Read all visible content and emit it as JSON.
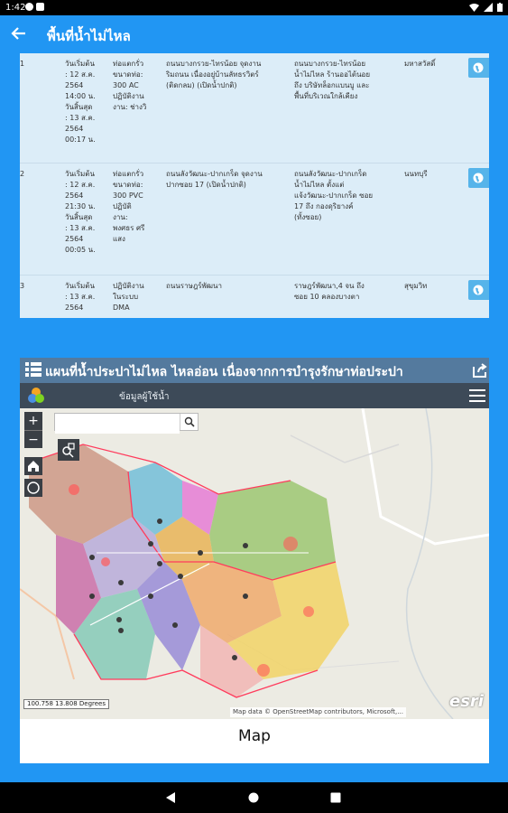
{
  "status_bar": {
    "time": "1:42"
  },
  "app_bar": {
    "title": "พื้นที่น้ำไม่ไหล"
  },
  "table": {
    "rows": [
      {
        "number": "1",
        "date": "วันเริ่มต้น\n: 12 ส.ค.\n2564\n14:00 น.\nวันสิ้นสุด\n: 13 ส.ค.\n2564\n00:17 น.",
        "cause": "ท่อแตกรั่ว\nขนาดท่อ:\n300 AC\nปฏิบัติงาน\nงาน: ช่างวิ",
        "road": "ถนนบางกรวย-ไทรน้อย จุดงาน\nริมถนน เนื่องอยู่บ้านลัทธรวิตร์\n(ติดกลม) (เปิดน้ำปกติ)",
        "area": "ถนนบางกรวย-ไทรน้อย\nน้ำไม่ไหล ร้านออไต้นอย\nถึง บริษัทล็อกแบนบู และ\nพื้นที่บริเวณใกล้เคียง",
        "district": "มหาสวัสดิ์"
      },
      {
        "number": "2",
        "date": "วันเริ่มต้น\n: 12 ส.ค.\n2564\n21:30 น.\nวันสิ้นสุด\n: 13 ส.ค.\n2564\n00:05 น.",
        "cause": "ท่อแตกรั่ว\nขนาดท่อ:\n300 PVC\nปฏิบัติ\nงาน:\nพงศธร ศรี\nแสง",
        "road": "ถนนลังวัฒนะ-ปากเกร็ด จุดงาน\nปากซอย 17 (เปิดน้ำปกติ)",
        "area": "ถนนลังวัฒนะ-ปากเกร็ด\nน้ำไม่ไหล ตั้งแต่\nแจ้งวัฒนะ-ปากเกร็ด ซอย\n17 ถึง กองดุริยางค์\n(ทั้งซอย)",
        "district": "นนทบุรี"
      },
      {
        "number": "3",
        "date": "วันเริ่มต้น\n: 13 ส.ค.\n2564",
        "cause": "ปฏิบัติงาน\nในระบบ\nDMA",
        "road": "ถนนราษฎร์พัฒนา",
        "area": "ราษฎร์พัฒนา,4 จน ถึง\nซอย 10 คลองบางตา",
        "district": "สุขุมวิท"
      }
    ]
  },
  "map_section": {
    "header_title": "แผนที่น้ำประปาไม่ไหล ไหลอ่อน เนื่องจากการบำรุงรักษาท่อประปา",
    "toolbar_label": "ข้อมูลผู้ใช้น้ำ",
    "search": {
      "placeholder": "",
      "value": ""
    },
    "zoom_in": "+",
    "zoom_out": "−",
    "scale_text": "100.758 13.808 Degrees",
    "attribution": "Map data © OpenStreetMap contributors, Microsoft,...",
    "esri_logo": "esri",
    "caption": "Map"
  },
  "icons": {
    "back": "arrow-left-icon",
    "list": "list-icon",
    "share": "share-icon",
    "locate": "globe-icon",
    "home": "home-icon",
    "locate_me": "circle-icon",
    "search": "search-icon",
    "menu": "hamburger-menu-icon"
  },
  "colors": {
    "primary": "#2196f3",
    "table_bg": "#dcedf8",
    "map_header": "#547a9e",
    "map_toolbar": "#3d4a58",
    "locate_button": "#56b4ea"
  }
}
